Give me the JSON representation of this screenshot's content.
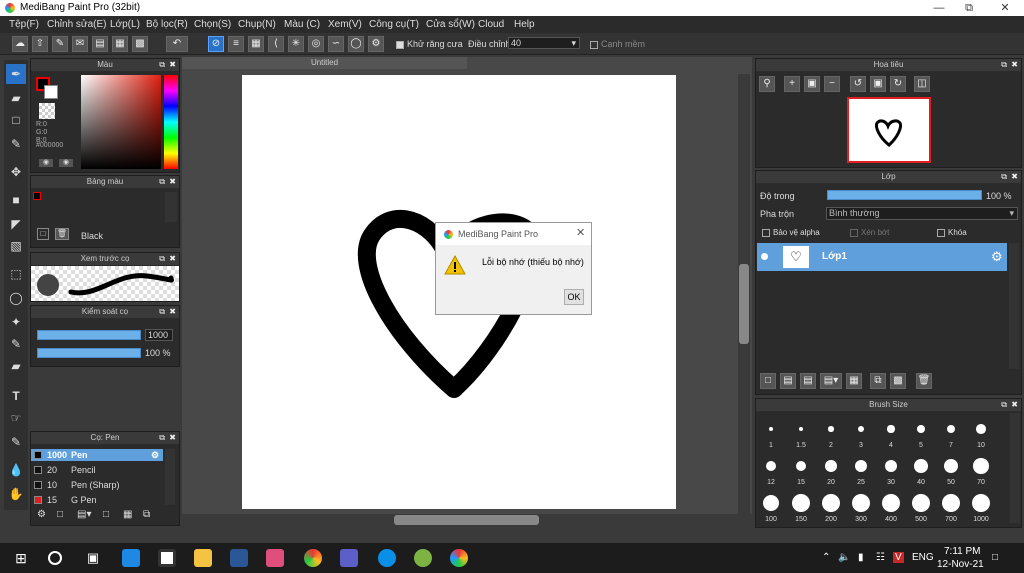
{
  "window": {
    "title": "MediBang Paint Pro (32bit)"
  },
  "menu": [
    "Tệp(F)",
    "Chỉnh sửa(E)",
    "Lớp(L)",
    "Bộ lọc(R)",
    "Chọn(S)",
    "Chụp(N)",
    "Màu (C)",
    "Xem(V)",
    "Công cụ(T)",
    "Cửa sổ(W)",
    "Cloud",
    "Help"
  ],
  "toolbar": {
    "antialias_label": "Khử răng cưa",
    "adjust_label": "Điều chỉnh",
    "adjust_value": "40",
    "smooth_label": "Cạnh mềm"
  },
  "color_panel": {
    "title": "Màu",
    "r": "R:0",
    "g": "G:0",
    "b": "B:0",
    "hex": "#000000"
  },
  "palette_panel": {
    "title": "Bảng màu",
    "color_name": "Black"
  },
  "brush_preview": {
    "title": "Xem trước cọ"
  },
  "brush_control": {
    "title": "Kiểm soát cọ",
    "size_value": "1000",
    "opacity_value": "100 %"
  },
  "brush_list": {
    "title": "Cọ: Pen",
    "items": [
      {
        "size": "1000",
        "name": "Pen",
        "color": "#000000"
      },
      {
        "size": "20",
        "name": "Pencil",
        "color": "#111111"
      },
      {
        "size": "10",
        "name": "Pen (Sharp)",
        "color": "#111111"
      },
      {
        "size": "15",
        "name": "G Pen",
        "color": "#e02020"
      }
    ]
  },
  "document": {
    "name": "Untitled"
  },
  "dialog": {
    "title": "MediBang Paint Pro",
    "message": "Lỗi bộ nhớ (thiếu bộ nhớ)",
    "ok": "OK"
  },
  "navigator": {
    "title": "Hoa tiêu"
  },
  "layer_panel": {
    "title": "Lớp",
    "opacity_label": "Độ trong",
    "opacity_value": "100 %",
    "blend_label": "Pha trộn",
    "blend_value": "Bình thường",
    "protect_alpha": "Bảo vệ alpha",
    "clip": "Xén bớt",
    "lock": "Khóa",
    "layer_name": "Lớp1"
  },
  "brush_size": {
    "title": "Brush Size",
    "sizes": [
      "1",
      "1.5",
      "2",
      "3",
      "4",
      "5",
      "7",
      "10",
      "12",
      "15",
      "20",
      "25",
      "30",
      "40",
      "50",
      "70",
      "100",
      "150",
      "200",
      "300",
      "400",
      "500",
      "700",
      "1000"
    ]
  },
  "taskbar": {
    "lang": "ENG",
    "time": "7:11 PM",
    "date": "12-Nov-21"
  }
}
